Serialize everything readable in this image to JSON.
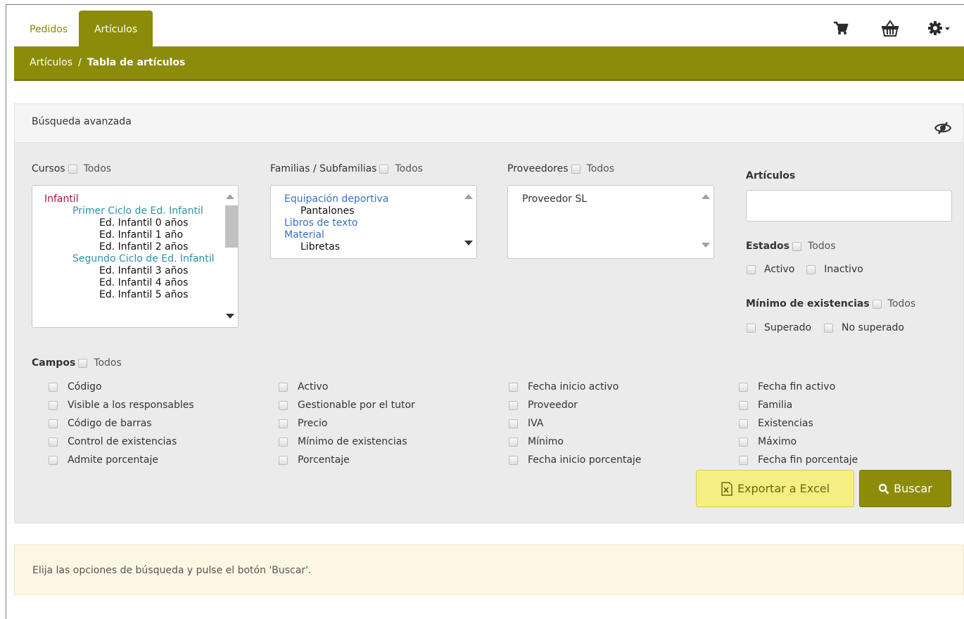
{
  "tabs": [
    {
      "label": "Pedidos",
      "active": false
    },
    {
      "label": "Artículos",
      "active": true
    }
  ],
  "top_icons": [
    "cart-icon",
    "basket-icon",
    "gear-icon"
  ],
  "breadcrumb": {
    "parent": "Artículos",
    "separator": "/",
    "current": "Tabla de artículos"
  },
  "panel": {
    "title": "Búsqueda avanzada"
  },
  "todos": "Todos",
  "cursos": {
    "label": "Cursos",
    "items": [
      {
        "text": "Infantil",
        "level": 0,
        "color": "#b0103a"
      },
      {
        "text": "Primer Ciclo de Ed. Infantil",
        "level": 1,
        "color": "#2a93a8"
      },
      {
        "text": "Ed. Infantil 0 años",
        "level": 2,
        "color": "#111111"
      },
      {
        "text": "Ed. Infantil 1 año",
        "level": 2,
        "color": "#111111"
      },
      {
        "text": "Ed. Infantil 2 años",
        "level": 2,
        "color": "#111111"
      },
      {
        "text": "Segundo Ciclo de Ed. Infantil",
        "level": 1,
        "color": "#2a93a8"
      },
      {
        "text": "Ed. Infantil 3 años",
        "level": 2,
        "color": "#111111"
      },
      {
        "text": "Ed. Infantil 4 años",
        "level": 2,
        "color": "#111111"
      },
      {
        "text": "Ed. Infantil 5 años",
        "level": 2,
        "color": "#111111"
      }
    ]
  },
  "familias": {
    "label": "Familias / Subfamilias",
    "items": [
      {
        "text": "Equipación deportiva",
        "level": 0,
        "color": "#3a6fc0"
      },
      {
        "text": "Pantalones",
        "level": 1,
        "color": "#111111"
      },
      {
        "text": "Libros de texto",
        "level": 0,
        "color": "#3a6fc0"
      },
      {
        "text": "Material",
        "level": 0,
        "color": "#3a6fc0"
      },
      {
        "text": "Libretas",
        "level": 1,
        "color": "#111111"
      }
    ]
  },
  "proveedores": {
    "label": "Proveedores",
    "items": [
      {
        "text": "Proveedor SL"
      }
    ]
  },
  "articulos": {
    "label": "Artículos",
    "value": ""
  },
  "estados": {
    "label": "Estados",
    "options": [
      "Activo",
      "Inactivo"
    ]
  },
  "minimo": {
    "label": "Mínimo de existencias",
    "options": [
      "Superado",
      "No superado"
    ]
  },
  "campos": {
    "label": "Campos",
    "columns": [
      [
        "Código",
        "Visible a los responsables",
        "Código de barras",
        "Control de existencias",
        "Admite porcentaje"
      ],
      [
        "Activo",
        "Gestionable por el tutor",
        "Precio",
        "Mínimo de existencias",
        "Porcentaje"
      ],
      [
        "Fecha inicio activo",
        "Proveedor",
        "IVA",
        "Mínimo",
        "Fecha inicio porcentaje"
      ],
      [
        "Fecha fin activo",
        "Familia",
        "Existencias",
        "Máximo",
        "Fecha fin porcentaje"
      ]
    ]
  },
  "buttons": {
    "export": "Exportar a Excel",
    "search": "Buscar"
  },
  "message": "Elija las opciones de búsqueda y pulse el botón 'Buscar'.",
  "colors": {
    "brand": "#8c8c0a",
    "excel_bg": "#f5ee83",
    "panel_bg": "#ebebeb",
    "alert_bg": "#fcf7e3"
  }
}
